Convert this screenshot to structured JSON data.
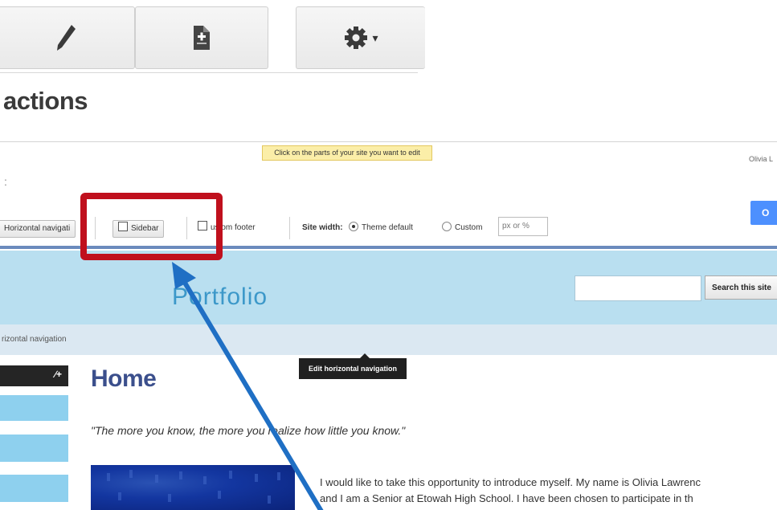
{
  "toolbar": {
    "buttons": [
      {
        "icon": "pencil-icon"
      },
      {
        "icon": "new-page-icon"
      },
      {
        "icon": "gear-icon"
      }
    ]
  },
  "section_title": "actions",
  "editor": {
    "tooltip": "Click on the parts of your site you want to edit",
    "user_name": "Olivia L",
    "blue_button_label": "O",
    "options": {
      "horizontal_nav": "Horizontal navigati",
      "sidebar": "Sidebar",
      "custom_footer": "ustom footer",
      "site_width_label": "Site width:",
      "theme_default": "Theme default",
      "custom": "Custom",
      "px_placeholder": "px or %"
    },
    "site": {
      "title": "Portfolio",
      "search_button": "Search this site",
      "nav_label": "rizontal navigation",
      "nav_tooltip": "Edit horizontal navigation",
      "sidebar_head_icon": "∕+",
      "page_heading": "Home",
      "quote": "\"The more you know, the more you realize how little you know.\"",
      "body_lines": [
        "I would like to take this opportunity to introduce myself.  My name is Olivia Lawrenc",
        "and I am a Senior at Etowah High School.  I have been chosen to participate in th"
      ]
    }
  },
  "colors": {
    "highlight": "#c0101d",
    "arrow": "#1f6fc4",
    "banner": "#b9dff0",
    "title": "#3c98c9"
  }
}
